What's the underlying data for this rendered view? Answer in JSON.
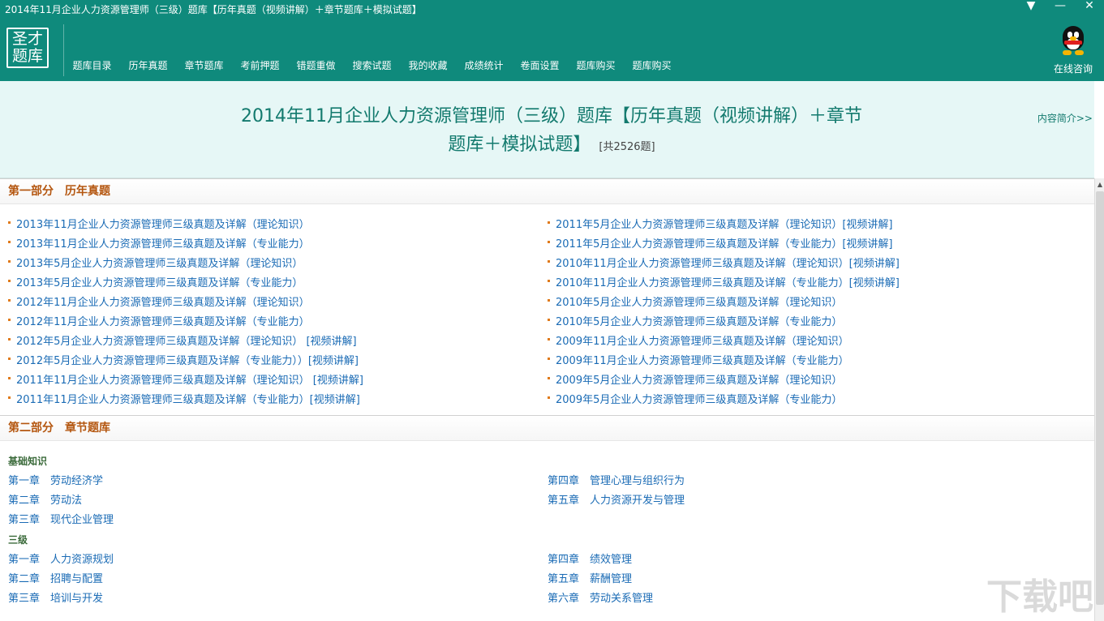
{
  "window": {
    "title": "2014年11月企业人力资源管理师（三级）题库【历年真题（视频讲解）＋章节题库＋模拟试题】",
    "controls": {
      "menu": "▼",
      "minimize": "—",
      "close": "✕"
    }
  },
  "logo": {
    "line1": "圣才",
    "line2": "题库"
  },
  "nav": [
    "题库目录",
    "历年真题",
    "章节题库",
    "考前押题",
    "错题重做",
    "搜索试题",
    "我的收藏",
    "成绩统计",
    "卷面设置",
    "题库购买",
    "题库购买"
  ],
  "consult": {
    "label": "在线咨询",
    "icon": "qq-penguin-icon"
  },
  "hero": {
    "title_line1": "2014年11月企业人力资源管理师（三级）题库【历年真题（视频讲解）＋章节",
    "title_line2": "题库＋模拟试题】",
    "count": "[共2526题]",
    "intro_link": "内容简介>>"
  },
  "section1": {
    "title": "第一部分　历年真题",
    "left_links": [
      "2013年11月企业人力资源管理师三级真题及详解（理论知识）",
      "2013年11月企业人力资源管理师三级真题及详解（专业能力）",
      "2013年5月企业人力资源管理师三级真题及详解（理论知识）",
      "2013年5月企业人力资源管理师三级真题及详解（专业能力）",
      "2012年11月企业人力资源管理师三级真题及详解（理论知识）",
      "2012年11月企业人力资源管理师三级真题及详解（专业能力）",
      "2012年5月企业人力资源管理师三级真题及详解（理论知识） [视频讲解]",
      "2012年5月企业人力资源管理师三级真题及详解（专业能力））[视频讲解]",
      "2011年11月企业人力资源管理师三级真题及详解（理论知识） [视频讲解]",
      "2011年11月企业人力资源管理师三级真题及详解（专业能力）[视频讲解]"
    ],
    "right_links": [
      "2011年5月企业人力资源管理师三级真题及详解（理论知识）[视频讲解]",
      "2011年5月企业人力资源管理师三级真题及详解（专业能力）[视频讲解]",
      "2010年11月企业人力资源管理师三级真题及详解（理论知识）[视频讲解]",
      "2010年11月企业人力资源管理师三级真题及详解（专业能力）[视频讲解]",
      "2010年5月企业人力资源管理师三级真题及详解（理论知识）",
      "2010年5月企业人力资源管理师三级真题及详解（专业能力）",
      "2009年11月企业人力资源管理师三级真题及详解（理论知识）",
      "2009年11月企业人力资源管理师三级真题及详解（专业能力）",
      "2009年5月企业人力资源管理师三级真题及详解（理论知识）",
      "2009年5月企业人力资源管理师三级真题及详解（专业能力）"
    ]
  },
  "section2": {
    "title": "第二部分　章节题库",
    "group1": {
      "title": "基础知识",
      "left": [
        "第一章　劳动经济学",
        "第二章　劳动法",
        "第三章　现代企业管理"
      ],
      "right": [
        "第四章　管理心理与组织行为",
        "第五章　人力资源开发与管理"
      ]
    },
    "group2": {
      "title": "三级",
      "left": [
        "第一章　人力资源规划",
        "第二章　招聘与配置",
        "第三章　培训与开发"
      ],
      "right": [
        "第四章　绩效管理",
        "第五章　薪酬管理",
        "第六章　劳动关系管理"
      ]
    }
  },
  "watermark": "下载吧"
}
